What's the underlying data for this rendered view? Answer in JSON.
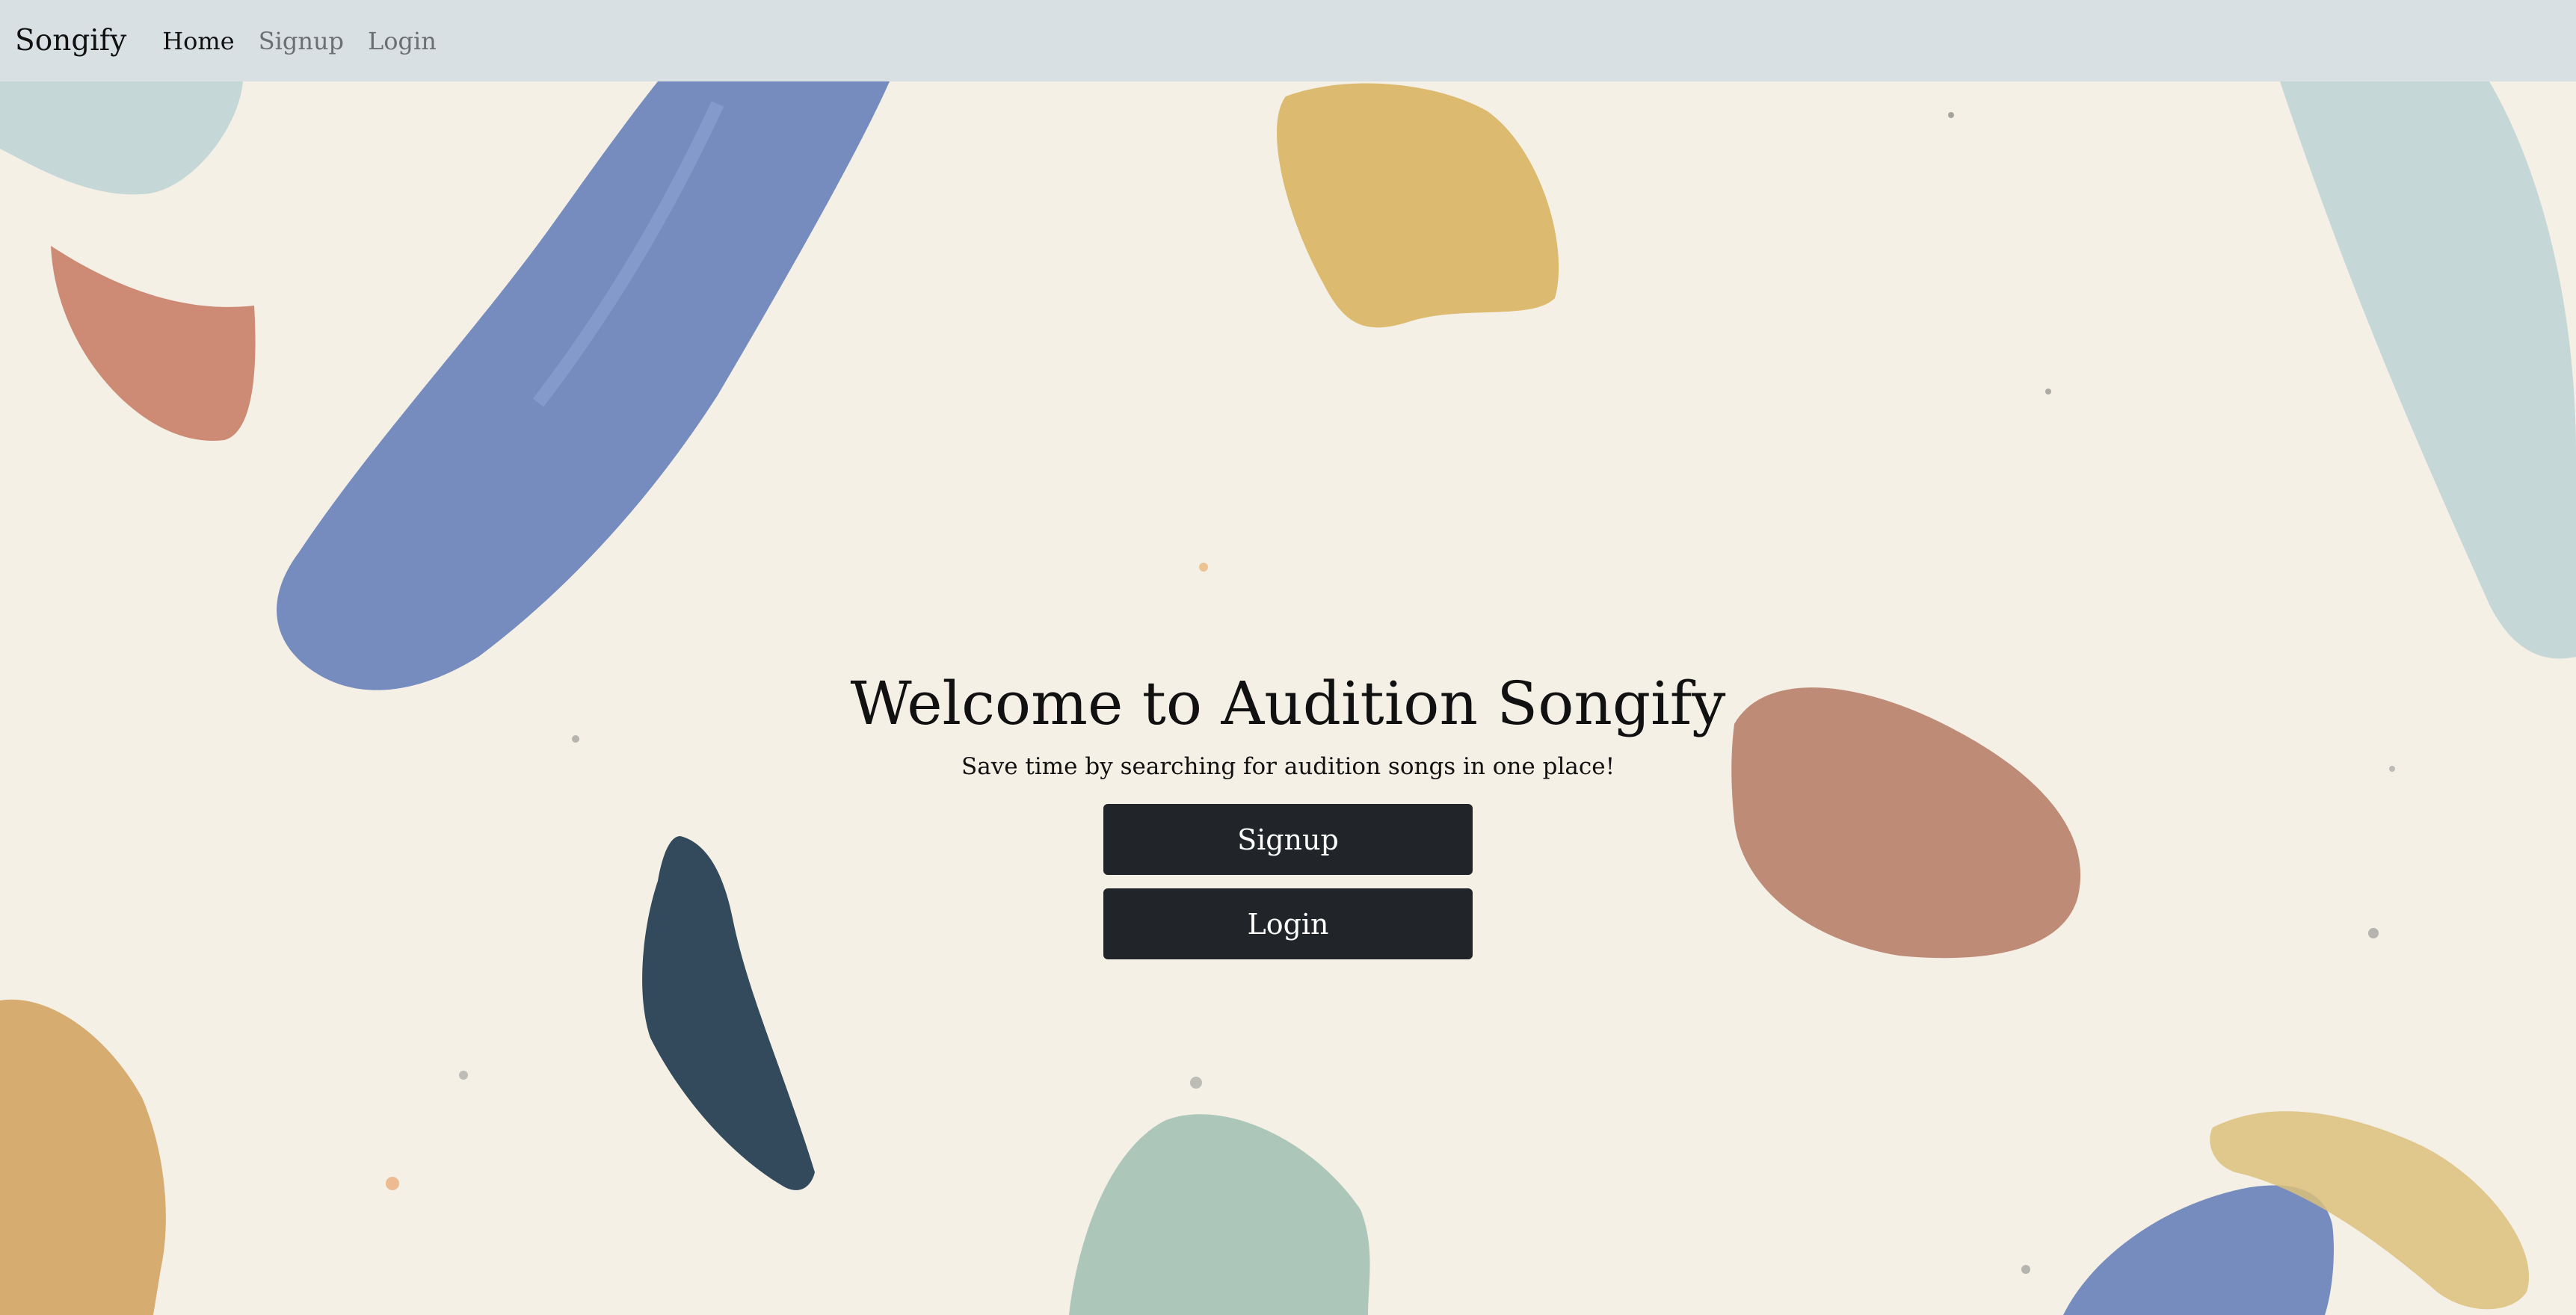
{
  "navbar": {
    "brand": "Songify",
    "links": [
      {
        "label": "Home",
        "active": true
      },
      {
        "label": "Signup",
        "active": false
      },
      {
        "label": "Login",
        "active": false
      }
    ]
  },
  "hero": {
    "title": "Welcome to Audition Songify",
    "subtitle": "Save time by searching for audition songs in one place!",
    "signup_label": "Signup",
    "login_label": "Login"
  },
  "colors": {
    "navbar_bg": "#d8e0e3",
    "page_bg": "#f5f0e6",
    "button_bg": "#212529",
    "stroke_blue": "#6f86bd",
    "stroke_orange": "#c97f68",
    "stroke_mustard": "#d9b563",
    "stroke_teal": "#bcd3d3",
    "stroke_navy": "#334a5c",
    "stroke_terracotta": "#bb8570",
    "stroke_sage": "#a4c1b4"
  }
}
